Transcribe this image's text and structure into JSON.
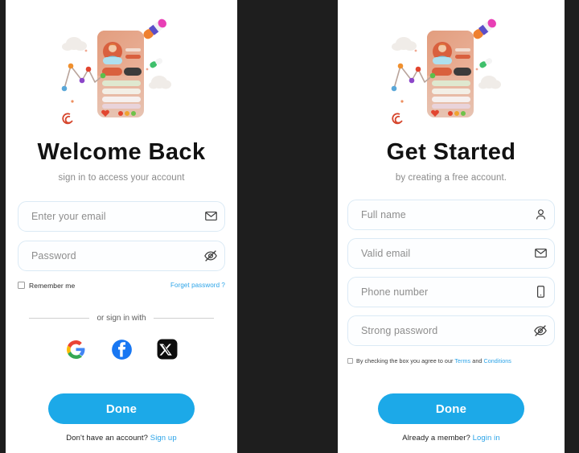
{
  "theme": {
    "accent_blue": "#1ca9e8",
    "link_blue": "#2aa3e8",
    "field_border": "#dbeaf5",
    "page_background": "#ffffff",
    "gutter_background": "#1e1e1e",
    "title_color": "#121212",
    "subtitle_color": "#8a8a8a"
  },
  "login": {
    "title": "Welcome Back",
    "subtitle": "sign in to access your account",
    "illustration_name": "profile-card-3d-illustration",
    "fields": [
      {
        "placeholder": "Enter your email",
        "icon": "envelope-icon",
        "name": "email-field"
      },
      {
        "placeholder": "Password",
        "icon": "eye-off-icon",
        "name": "password-field"
      }
    ],
    "remember_label": "Remember me",
    "forget_label": "Forget password ?",
    "divider_label": "or sign in with",
    "socials": [
      {
        "name": "google-signin-button",
        "icon": "google-icon"
      },
      {
        "name": "facebook-signin-button",
        "icon": "facebook-icon"
      },
      {
        "name": "x-signin-button",
        "icon": "x-icon"
      }
    ],
    "submit_label": "Done",
    "footer_text": "Don't have an account?",
    "footer_link": "Sign up"
  },
  "signup": {
    "title": "Get Started",
    "subtitle": "by creating a free account.",
    "illustration_name": "profile-card-3d-illustration",
    "fields": [
      {
        "placeholder": "Full name",
        "icon": "person-icon",
        "name": "full-name-field"
      },
      {
        "placeholder": "Valid email",
        "icon": "envelope-icon",
        "name": "email-field"
      },
      {
        "placeholder": "Phone number",
        "icon": "phone-icon",
        "name": "phone-field"
      },
      {
        "placeholder": "Strong password",
        "icon": "eye-off-icon",
        "name": "password-field"
      }
    ],
    "terms_prefix": "By checking the box you agree to our ",
    "terms_link_1": "Terms",
    "terms_middle": " and ",
    "terms_link_2": "Conditions",
    "submit_label": "Done",
    "footer_text": "Already a member?",
    "footer_link": "Login in"
  }
}
